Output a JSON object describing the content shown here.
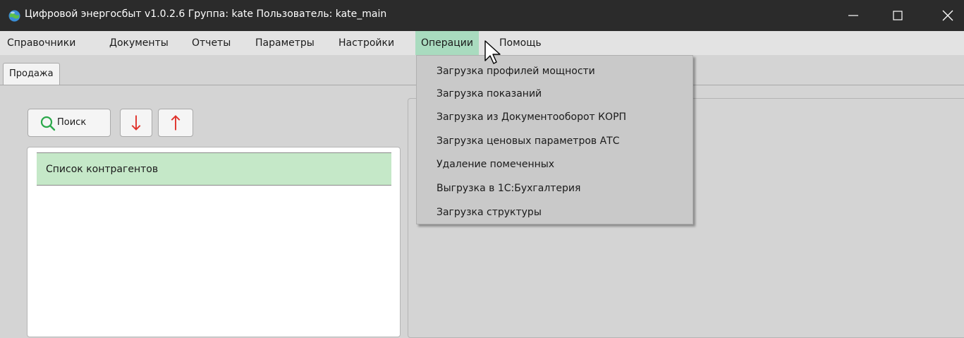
{
  "window": {
    "title": "Цифровой энергосбыт v1.0.2.6 Группа: kate Пользователь: kate_main",
    "icon": "globe-icon"
  },
  "menubar": {
    "items": [
      {
        "label": "Справочники",
        "active": false
      },
      {
        "label": "Документы",
        "active": false
      },
      {
        "label": "Отчеты",
        "active": false
      },
      {
        "label": "Параметры",
        "active": false
      },
      {
        "label": "Настройки",
        "active": false
      },
      {
        "label": "Операции",
        "active": true
      },
      {
        "label": "Помощь",
        "active": false
      }
    ]
  },
  "dropdown": {
    "items": [
      "Загрузка профилей мощности",
      "Загрузка показаний",
      "Загрузка из Документооборот КОРП",
      "Загрузка ценовых параметров АТС",
      "Удаление помеченных",
      "Выгрузка в 1С:Бухгалтерия",
      "Загрузка структуры"
    ]
  },
  "tabs": [
    {
      "label": "Продажа",
      "active": true
    }
  ],
  "toolbar": {
    "search_label": "Поиск",
    "down_icon": "arrow-down-icon",
    "up_icon": "arrow-up-icon"
  },
  "list": {
    "header": "Список контрагентов"
  },
  "colors": {
    "titlebar": "#2b2b2b",
    "menu_active": "#a9dbbf",
    "list_header": "#c5e8c8",
    "arrow_red": "#e0312a",
    "search_green": "#2aa84a"
  }
}
